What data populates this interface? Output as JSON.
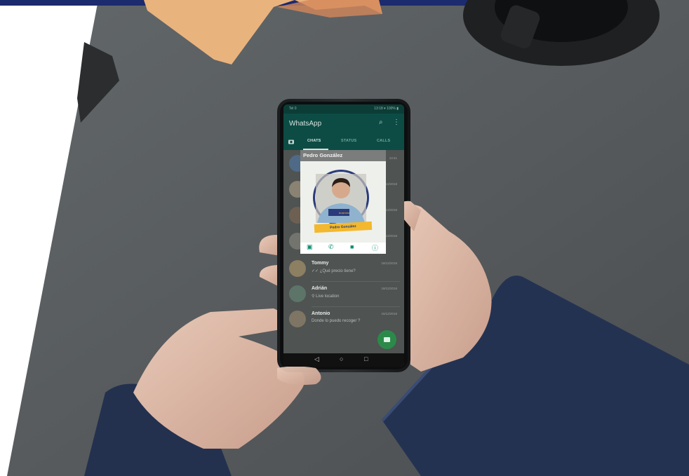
{
  "image": {
    "description": "Photo of two hands holding an Android phone showing a chat list, a contact profile popup open on a dark desk",
    "colors": {
      "desk": "#5a5e5f",
      "sleeve": "#23314f",
      "skin": "#d9b8a8",
      "brand_bar": "#1c2a6e",
      "app_green": "#0c4c44"
    }
  },
  "phone": {
    "status_bar": {
      "left": "Tel 0",
      "right": "13:18 ▾ 100% ▮"
    },
    "app_title": "WhatsApp",
    "icons": [
      "search-icon",
      "more-vert-icon",
      "camera-icon"
    ],
    "tabs": [
      "CHATS",
      "STATUS",
      "CALLS"
    ],
    "chats": [
      {
        "name": "Tommy",
        "message": "✓✓ ¿Qué precio tiene?",
        "time": "18/12/2018"
      },
      {
        "name": "Adrián",
        "message": "⚲ Live location",
        "time": "18/12/2018"
      },
      {
        "name": "Antonio",
        "message": "Donde lo puedo recoger ?",
        "time": "16/12/2018"
      }
    ],
    "hidden_chat_times": [
      "13:41",
      "14/12/2018",
      "16/12/2018",
      "13/12/2018"
    ],
    "nav": [
      "◁",
      "○",
      "□"
    ]
  },
  "popup": {
    "name": "Pedro González",
    "banner": "Pedro González",
    "badge": "business",
    "actions": [
      "message-icon",
      "call-icon",
      "video-icon",
      "info-icon"
    ]
  }
}
